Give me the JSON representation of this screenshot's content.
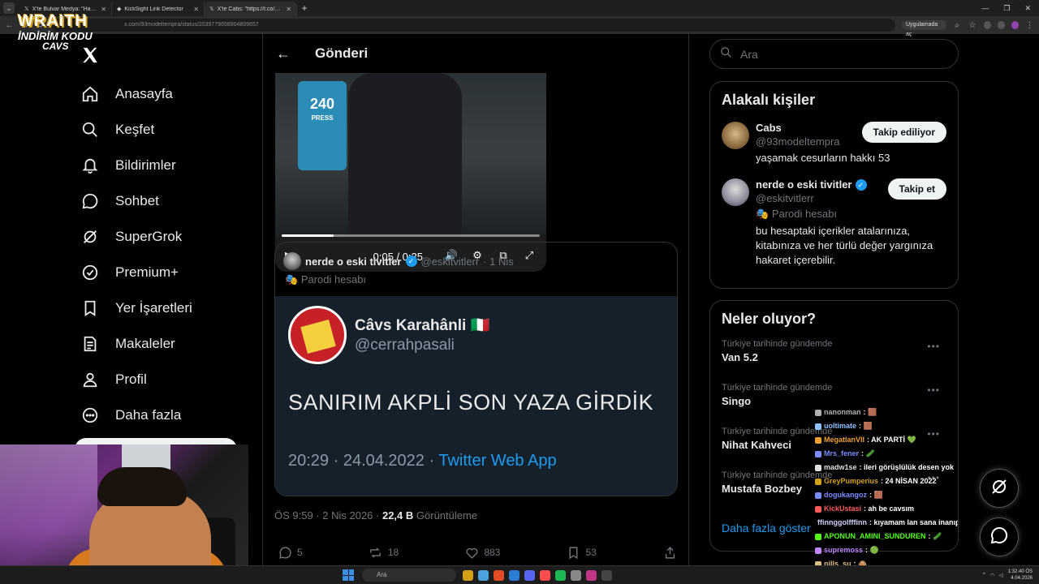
{
  "browser": {
    "tabs": [
      {
        "title": "X'te Bulvar Medya: \"Hastasıyla",
        "active": false
      },
      {
        "title": "KickSight Link Detector",
        "active": false
      },
      {
        "title": "X'te Cabs: \"https://t.co/ObfGuj",
        "active": true
      }
    ],
    "new_tab": "+",
    "url": "x.com/93modeltempra/status/2039779658904809657",
    "open_in_app": "Uygulamada aç"
  },
  "overlay_logo": {
    "line1": "WRAITH",
    "line2": "İNDİRİM KODU",
    "line3": "CAVS"
  },
  "x_logo": "X",
  "nav": {
    "items": [
      {
        "label": "Anasayfa",
        "icon": "home-icon"
      },
      {
        "label": "Keşfet",
        "icon": "search-icon"
      },
      {
        "label": "Bildirimler",
        "icon": "bell-icon"
      },
      {
        "label": "Sohbet",
        "icon": "chat-icon"
      },
      {
        "label": "SuperGrok",
        "icon": "grok-icon"
      },
      {
        "label": "Premium+",
        "icon": "verified-icon"
      },
      {
        "label": "Yer İşaretleri",
        "icon": "bookmark-icon"
      },
      {
        "label": "Makaleler",
        "icon": "article-icon"
      },
      {
        "label": "Profil",
        "icon": "person-icon"
      },
      {
        "label": "Daha fazla",
        "icon": "more-circle-icon"
      }
    ]
  },
  "main": {
    "title": "Gönderi",
    "video": {
      "press_number": "240",
      "press_label": "PRESS",
      "time": "0:05 / 0:25",
      "progress_fraction": 0.2
    },
    "quote": {
      "name": "nerde o eski tivitler",
      "handle": "@eskitvitlerr",
      "date": "· 1 Nis",
      "parody": "Parodi hesabı",
      "image": {
        "name": "Câvs Karahânli 🇮🇹",
        "handle": "@cerrahpasali",
        "text": "SANIRIM AKPLİ SON YAZA GİRDİK",
        "meta": "20:29 · 24.04.2022 ·",
        "app": "Twitter Web App"
      }
    },
    "meta": {
      "time": "ÖS 9:59 · 2 Nis 2026 ·",
      "views": "22,4 B",
      "views_label": "Görüntüleme"
    },
    "actions": {
      "replies": "5",
      "reposts": "18",
      "likes": "883",
      "bookmarks": "53"
    }
  },
  "right": {
    "search_placeholder": "Ara",
    "related": {
      "title": "Alakalı kişiler",
      "people": [
        {
          "name": "Cabs",
          "handle": "@93modeltempra",
          "bio": "yaşamak cesurların hakkı 53",
          "button": "Takip ediliyor",
          "verified": false,
          "parody": ""
        },
        {
          "name": "nerde o eski tivitler",
          "handle": "@eskitvitlerr",
          "bio": "bu hesaptaki içerikler atalarınıza, kitabınıza ve her türlü değer yargınıza hakaret içerebilir.",
          "button": "Takip et",
          "verified": true,
          "parody": "Parodi hesabı"
        }
      ]
    },
    "trends": {
      "title": "Neler oluyor?",
      "items": [
        {
          "context": "Türkiye tarihinde gündemde",
          "name": "Van 5.2"
        },
        {
          "context": "Türkiye tarihinde gündemde",
          "name": "Singo"
        },
        {
          "context": "Türkiye tarihinde gündemde",
          "name": "Nihat Kahveci"
        },
        {
          "context": "Türkiye tarihinde gündemde",
          "name": "Mustafa Bozbey"
        }
      ],
      "show_more": "Daha fazla göster"
    }
  },
  "chat": [
    {
      "user": "nanonman",
      "msg": ": 🟫",
      "color": "#b0b0b0"
    },
    {
      "user": "uoltimate",
      "msg": ": 🟫",
      "color": "#8fc1ff"
    },
    {
      "user": "MegatlanVII",
      "msg": ": AK PARTİ 💚",
      "color": "#f0a030"
    },
    {
      "user": "Mrs_fener",
      "msg": ": 🥒",
      "color": "#7b8cff"
    },
    {
      "user": "madw1se",
      "msg": ": ileri görüşlülük desen yok",
      "color": "#e0e0e0"
    },
    {
      "user": "GreyPumperius",
      "msg": ": 24 NİSAN 2022",
      "color": "#d4a017"
    },
    {
      "user": "dogukangoz",
      "msg": ": 🟫",
      "color": "#7b8cff"
    },
    {
      "user": "KickUstasi",
      "msg": ": ah be cavsım",
      "color": "#ff5a5a"
    },
    {
      "user": "ffinnggolfffinn",
      "msg": ": kıyamam lan sana inanıp yazmış bir de",
      "color": "#d0d0ff"
    },
    {
      "user": "APONUN_AMINI_SUNDUREN",
      "msg": ": 🥒",
      "color": "#53fc18"
    },
    {
      "user": "supremoss",
      "msg": ": 🟢",
      "color": "#c084fc"
    },
    {
      "user": "nills_su",
      "msg": ": 🙈",
      "color": "#e0c080"
    }
  ],
  "taskbar": {
    "search": "Ara",
    "time": "1:32:40 ÖS",
    "date": "4.04.2026"
  },
  "colors": {
    "accent": "#1d9bf0",
    "background": "#000000",
    "border": "#2f3336",
    "muted": "#71767b"
  }
}
